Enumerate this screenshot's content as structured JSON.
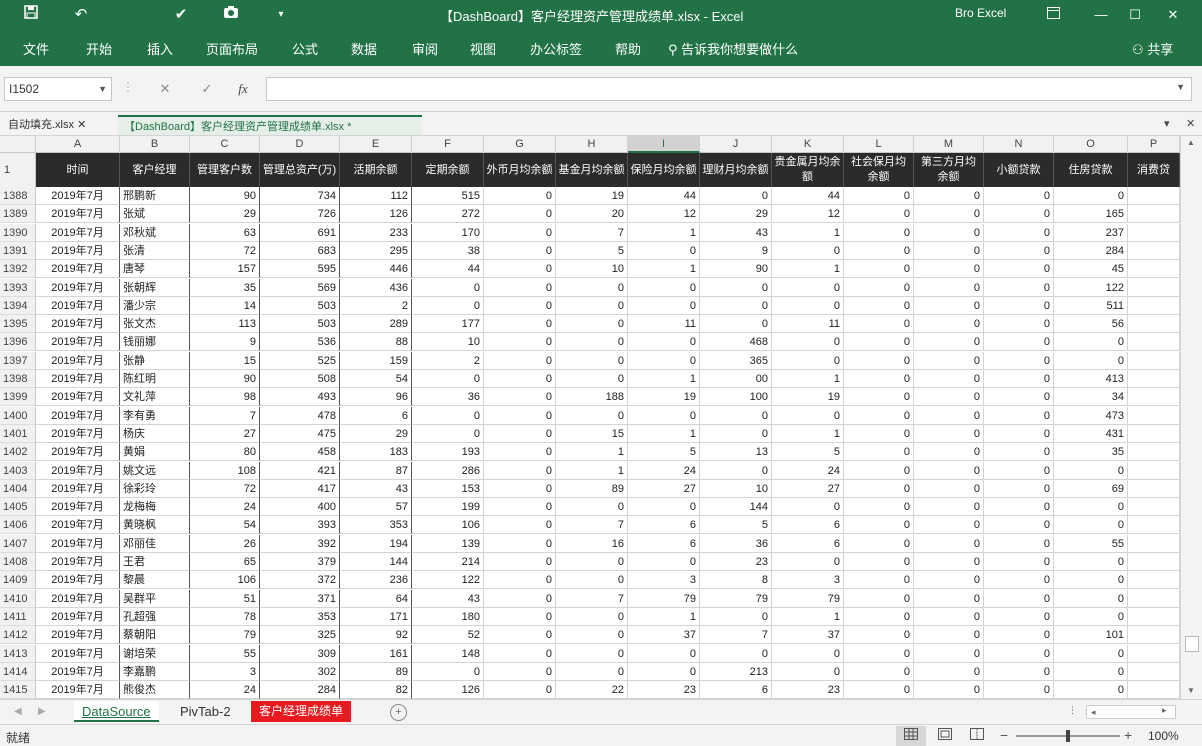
{
  "titlebar": {
    "title": "【DashBoard】客户经理资产管理成绩单.xlsx - Excel",
    "account": "Bro Excel",
    "qa_icons": [
      "save-icon",
      "undo-icon",
      "check-icon",
      "camera-icon",
      "customize-icon"
    ],
    "buttons": [
      "ribbon-display-icon",
      "minimize-icon",
      "maximize-icon",
      "close-icon"
    ]
  },
  "ribbon": {
    "tabs": [
      "文件",
      "开始",
      "插入",
      "页面布局",
      "公式",
      "数据",
      "审阅",
      "视图",
      "办公标签",
      "帮助"
    ],
    "tellme": "告诉我你想要做什么",
    "share": "共享"
  },
  "formula": {
    "namebox": "I1502",
    "cancel": "✕",
    "enter": "✓",
    "fx": "fx",
    "content": ""
  },
  "workbooks": {
    "tab1": "自动填充.xlsx",
    "tab2": "【DashBoard】客户经理资产管理成绩单.xlsx *"
  },
  "columns": [
    "A",
    "B",
    "C",
    "D",
    "E",
    "F",
    "G",
    "H",
    "I",
    "J",
    "K",
    "L",
    "M",
    "N",
    "O",
    "P"
  ],
  "selected_column": "I",
  "header_row_number": "1",
  "headers": [
    "时间",
    "客户经理",
    "管理客户数",
    "管理总资产(万)",
    "活期余额",
    "定期余额",
    "外币月均余额",
    "基金月均余额",
    "保险月均余额",
    "理财月均余额",
    "贵金属月均余额",
    "社会保月均余额",
    "第三方月均余额",
    "小额贷款",
    "住房贷款",
    "消费贷"
  ],
  "rows": [
    {
      "n": "1388",
      "cells": [
        "2019年7月",
        "邢鹏新",
        "90",
        "734",
        "112",
        "515",
        "0",
        "19",
        "44",
        "0",
        "44",
        "0",
        "0",
        "0",
        "0",
        ""
      ]
    },
    {
      "n": "1389",
      "cells": [
        "2019年7月",
        "张斌",
        "29",
        "726",
        "126",
        "272",
        "0",
        "20",
        "12",
        "29",
        "12",
        "0",
        "0",
        "0",
        "165",
        ""
      ]
    },
    {
      "n": "1390",
      "cells": [
        "2019年7月",
        "邓秋斌",
        "63",
        "691",
        "233",
        "170",
        "0",
        "7",
        "1",
        "43",
        "1",
        "0",
        "0",
        "0",
        "237",
        ""
      ]
    },
    {
      "n": "1391",
      "cells": [
        "2019年7月",
        "张清",
        "72",
        "683",
        "295",
        "38",
        "0",
        "5",
        "0",
        "9",
        "0",
        "0",
        "0",
        "0",
        "284",
        ""
      ]
    },
    {
      "n": "1392",
      "cells": [
        "2019年7月",
        "唐琴",
        "157",
        "595",
        "446",
        "44",
        "0",
        "10",
        "1",
        "90",
        "1",
        "0",
        "0",
        "0",
        "45",
        ""
      ]
    },
    {
      "n": "1393",
      "cells": [
        "2019年7月",
        "张朝辉",
        "35",
        "569",
        "436",
        "0",
        "0",
        "0",
        "0",
        "0",
        "0",
        "0",
        "0",
        "0",
        "122",
        ""
      ]
    },
    {
      "n": "1394",
      "cells": [
        "2019年7月",
        "潘少宗",
        "14",
        "503",
        "2",
        "0",
        "0",
        "0",
        "0",
        "0",
        "0",
        "0",
        "0",
        "0",
        "511",
        ""
      ]
    },
    {
      "n": "1395",
      "cells": [
        "2019年7月",
        "张文杰",
        "113",
        "503",
        "289",
        "177",
        "0",
        "0",
        "11",
        "0",
        "11",
        "0",
        "0",
        "0",
        "56",
        ""
      ]
    },
    {
      "n": "1396",
      "cells": [
        "2019年7月",
        "钱丽娜",
        "9",
        "536",
        "88",
        "10",
        "0",
        "0",
        "0",
        "468",
        "0",
        "0",
        "0",
        "0",
        "0",
        ""
      ]
    },
    {
      "n": "1397",
      "cells": [
        "2019年7月",
        "张静",
        "15",
        "525",
        "159",
        "2",
        "0",
        "0",
        "0",
        "365",
        "0",
        "0",
        "0",
        "0",
        "0",
        ""
      ]
    },
    {
      "n": "1398",
      "cells": [
        "2019年7月",
        "陈红明",
        "90",
        "508",
        "54",
        "0",
        "0",
        "0",
        "1",
        "00",
        "1",
        "0",
        "0",
        "0",
        "413",
        ""
      ]
    },
    {
      "n": "1399",
      "cells": [
        "2019年7月",
        "文礼萍",
        "98",
        "493",
        "96",
        "36",
        "0",
        "188",
        "19",
        "100",
        "19",
        "0",
        "0",
        "0",
        "34",
        ""
      ]
    },
    {
      "n": "1400",
      "cells": [
        "2019年7月",
        "李有勇",
        "7",
        "478",
        "6",
        "0",
        "0",
        "0",
        "0",
        "0",
        "0",
        "0",
        "0",
        "0",
        "473",
        ""
      ]
    },
    {
      "n": "1401",
      "cells": [
        "2019年7月",
        "杨庆",
        "27",
        "475",
        "29",
        "0",
        "0",
        "15",
        "1",
        "0",
        "1",
        "0",
        "0",
        "0",
        "431",
        ""
      ]
    },
    {
      "n": "1402",
      "cells": [
        "2019年7月",
        "黄娟",
        "80",
        "458",
        "183",
        "193",
        "0",
        "1",
        "5",
        "13",
        "5",
        "0",
        "0",
        "0",
        "35",
        ""
      ]
    },
    {
      "n": "1403",
      "cells": [
        "2019年7月",
        "姚文远",
        "108",
        "421",
        "87",
        "286",
        "0",
        "1",
        "24",
        "0",
        "24",
        "0",
        "0",
        "0",
        "0",
        ""
      ]
    },
    {
      "n": "1404",
      "cells": [
        "2019年7月",
        "徐彩玲",
        "72",
        "417",
        "43",
        "153",
        "0",
        "89",
        "27",
        "10",
        "27",
        "0",
        "0",
        "0",
        "69",
        ""
      ]
    },
    {
      "n": "1405",
      "cells": [
        "2019年7月",
        "龙梅梅",
        "24",
        "400",
        "57",
        "199",
        "0",
        "0",
        "0",
        "144",
        "0",
        "0",
        "0",
        "0",
        "0",
        ""
      ]
    },
    {
      "n": "1406",
      "cells": [
        "2019年7月",
        "黄晓枫",
        "54",
        "393",
        "353",
        "106",
        "0",
        "7",
        "6",
        "5",
        "6",
        "0",
        "0",
        "0",
        "0",
        ""
      ]
    },
    {
      "n": "1407",
      "cells": [
        "2019年7月",
        "邓丽佳",
        "26",
        "392",
        "194",
        "139",
        "0",
        "16",
        "6",
        "36",
        "6",
        "0",
        "0",
        "0",
        "55",
        ""
      ]
    },
    {
      "n": "1408",
      "cells": [
        "2019年7月",
        "王君",
        "65",
        "379",
        "144",
        "214",
        "0",
        "0",
        "0",
        "23",
        "0",
        "0",
        "0",
        "0",
        "0",
        ""
      ]
    },
    {
      "n": "1409",
      "cells": [
        "2019年7月",
        "黎晨",
        "106",
        "372",
        "236",
        "122",
        "0",
        "0",
        "3",
        "8",
        "3",
        "0",
        "0",
        "0",
        "0",
        ""
      ]
    },
    {
      "n": "1410",
      "cells": [
        "2019年7月",
        "吴群平",
        "51",
        "371",
        "64",
        "43",
        "0",
        "7",
        "79",
        "79",
        "79",
        "0",
        "0",
        "0",
        "0",
        ""
      ]
    },
    {
      "n": "1411",
      "cells": [
        "2019年7月",
        "孔超强",
        "78",
        "353",
        "171",
        "180",
        "0",
        "0",
        "1",
        "0",
        "1",
        "0",
        "0",
        "0",
        "0",
        ""
      ]
    },
    {
      "n": "1412",
      "cells": [
        "2019年7月",
        "蔡朝阳",
        "79",
        "325",
        "92",
        "52",
        "0",
        "0",
        "37",
        "7",
        "37",
        "0",
        "0",
        "0",
        "101",
        ""
      ]
    },
    {
      "n": "1413",
      "cells": [
        "2019年7月",
        "谢培荣",
        "55",
        "309",
        "161",
        "148",
        "0",
        "0",
        "0",
        "0",
        "0",
        "0",
        "0",
        "0",
        "0",
        ""
      ]
    },
    {
      "n": "1414",
      "cells": [
        "2019年7月",
        "李嘉鹏",
        "3",
        "302",
        "89",
        "0",
        "0",
        "0",
        "0",
        "213",
        "0",
        "0",
        "0",
        "0",
        "0",
        ""
      ]
    },
    {
      "n": "1415",
      "cells": [
        "2019年7月",
        "熊俊杰",
        "24",
        "284",
        "82",
        "126",
        "0",
        "22",
        "23",
        "6",
        "23",
        "0",
        "0",
        "0",
        "0",
        ""
      ]
    }
  ],
  "sheets": {
    "active": "DataSource",
    "second": "PivTab-2",
    "third": "客户经理成绩单",
    "add": "+"
  },
  "statusbar": {
    "ready": "就绪",
    "zoom_minus": "−",
    "zoom_plus": "+",
    "zoom": "100%"
  }
}
